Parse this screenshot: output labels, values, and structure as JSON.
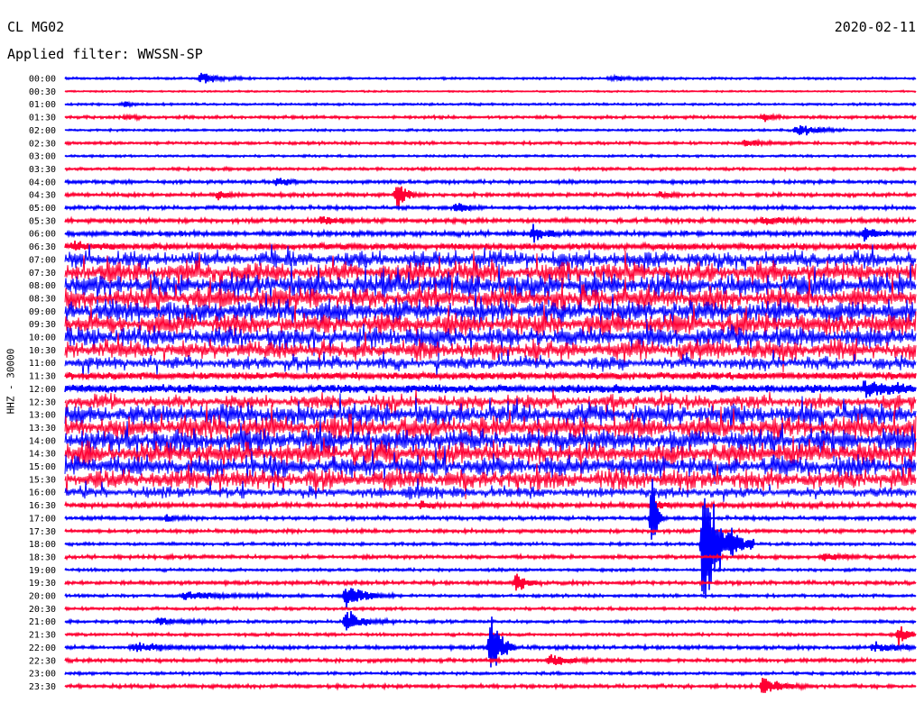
{
  "header": {
    "station": "CL MG02",
    "date": "2020-02-11",
    "filter": "Applied filter: WWSSN-SP"
  },
  "chart_data": {
    "type": "line",
    "title": "",
    "ylabel": "HHZ - 30000",
    "xlabel": "",
    "colors": [
      "#0000ff",
      "#ff0033"
    ],
    "grid": false,
    "legend": "none",
    "rows": [
      {
        "label": "00:00",
        "level": 0.15,
        "color": "#0000ff"
      },
      {
        "label": "00:30",
        "level": 0.1,
        "color": "#ff0033"
      },
      {
        "label": "01:00",
        "level": 0.15,
        "color": "#0000ff"
      },
      {
        "label": "01:30",
        "level": 0.2,
        "color": "#ff0033"
      },
      {
        "label": "02:00",
        "level": 0.15,
        "color": "#0000ff"
      },
      {
        "label": "02:30",
        "level": 0.2,
        "color": "#ff0033"
      },
      {
        "label": "03:00",
        "level": 0.15,
        "color": "#0000ff"
      },
      {
        "label": "03:30",
        "level": 0.2,
        "color": "#ff0033"
      },
      {
        "label": "04:00",
        "level": 0.25,
        "color": "#0000ff"
      },
      {
        "label": "04:30",
        "level": 0.25,
        "color": "#ff0033"
      },
      {
        "label": "05:00",
        "level": 0.25,
        "color": "#0000ff"
      },
      {
        "label": "05:30",
        "level": 0.3,
        "color": "#ff0033"
      },
      {
        "label": "06:00",
        "level": 0.35,
        "color": "#0000ff"
      },
      {
        "label": "06:30",
        "level": 0.45,
        "color": "#ff0033"
      },
      {
        "label": "07:00",
        "level": 1.2,
        "color": "#0000ff"
      },
      {
        "label": "07:30",
        "level": 1.5,
        "color": "#ff0033"
      },
      {
        "label": "08:00",
        "level": 1.6,
        "color": "#0000ff"
      },
      {
        "label": "08:30",
        "level": 1.6,
        "color": "#ff0033"
      },
      {
        "label": "09:00",
        "level": 1.6,
        "color": "#0000ff"
      },
      {
        "label": "09:30",
        "level": 1.5,
        "color": "#ff0033"
      },
      {
        "label": "10:00",
        "level": 1.5,
        "color": "#0000ff"
      },
      {
        "label": "10:30",
        "level": 1.4,
        "color": "#ff0033"
      },
      {
        "label": "11:00",
        "level": 0.9,
        "color": "#0000ff"
      },
      {
        "label": "11:30",
        "level": 0.5,
        "color": "#ff0033"
      },
      {
        "label": "12:00",
        "level": 0.6,
        "color": "#0000ff"
      },
      {
        "label": "12:30",
        "level": 1.0,
        "color": "#ff0033"
      },
      {
        "label": "13:00",
        "level": 1.5,
        "color": "#0000ff"
      },
      {
        "label": "13:30",
        "level": 1.6,
        "color": "#ff0033"
      },
      {
        "label": "14:00",
        "level": 1.6,
        "color": "#0000ff"
      },
      {
        "label": "14:30",
        "level": 1.6,
        "color": "#ff0033"
      },
      {
        "label": "15:00",
        "level": 1.5,
        "color": "#0000ff"
      },
      {
        "label": "15:30",
        "level": 1.4,
        "color": "#ff0033"
      },
      {
        "label": "16:00",
        "level": 0.8,
        "color": "#0000ff"
      },
      {
        "label": "16:30",
        "level": 0.35,
        "color": "#ff0033"
      },
      {
        "label": "17:00",
        "level": 0.25,
        "color": "#0000ff"
      },
      {
        "label": "17:30",
        "level": 0.25,
        "color": "#ff0033"
      },
      {
        "label": "18:00",
        "level": 0.2,
        "color": "#0000ff"
      },
      {
        "label": "18:30",
        "level": 0.25,
        "color": "#ff0033"
      },
      {
        "label": "19:00",
        "level": 0.2,
        "color": "#0000ff"
      },
      {
        "label": "19:30",
        "level": 0.25,
        "color": "#ff0033"
      },
      {
        "label": "20:00",
        "level": 0.2,
        "color": "#0000ff"
      },
      {
        "label": "20:30",
        "level": 0.2,
        "color": "#ff0033"
      },
      {
        "label": "21:00",
        "level": 0.2,
        "color": "#0000ff"
      },
      {
        "label": "21:30",
        "level": 0.2,
        "color": "#ff0033"
      },
      {
        "label": "22:00",
        "level": 0.25,
        "color": "#0000ff"
      },
      {
        "label": "22:30",
        "level": 0.25,
        "color": "#ff0033"
      },
      {
        "label": "23:00",
        "level": 0.2,
        "color": "#0000ff"
      },
      {
        "label": "23:30",
        "level": 0.25,
        "color": "#ff0033"
      }
    ],
    "events": [
      {
        "row": "00:00",
        "t": 0.16,
        "amp": 8,
        "dur": 0.02
      },
      {
        "row": "00:00",
        "t": 0.64,
        "amp": 3,
        "dur": 0.03
      },
      {
        "row": "01:00",
        "t": 0.07,
        "amp": 4,
        "dur": 0.01
      },
      {
        "row": "01:30",
        "t": 0.07,
        "amp": 4,
        "dur": 0.01
      },
      {
        "row": "01:30",
        "t": 0.82,
        "amp": 5,
        "dur": 0.01
      },
      {
        "row": "02:00",
        "t": 0.86,
        "amp": 10,
        "dur": 0.02
      },
      {
        "row": "02:30",
        "t": 0.8,
        "amp": 5,
        "dur": 0.02
      },
      {
        "row": "04:00",
        "t": 0.25,
        "amp": 8,
        "dur": 0.01
      },
      {
        "row": "04:30",
        "t": 0.39,
        "amp": 18,
        "dur": 0.01
      },
      {
        "row": "04:30",
        "t": 0.18,
        "amp": 6,
        "dur": 0.01
      },
      {
        "row": "04:30",
        "t": 0.7,
        "amp": 6,
        "dur": 0.01
      },
      {
        "row": "05:00",
        "t": 0.46,
        "amp": 10,
        "dur": 0.01
      },
      {
        "row": "05:30",
        "t": 0.3,
        "amp": 6,
        "dur": 0.02
      },
      {
        "row": "05:30",
        "t": 0.82,
        "amp": 6,
        "dur": 0.02
      },
      {
        "row": "06:00",
        "t": 0.55,
        "amp": 12,
        "dur": 0.01
      },
      {
        "row": "06:00",
        "t": 0.94,
        "amp": 14,
        "dur": 0.01
      },
      {
        "row": "06:30",
        "t": 0.01,
        "amp": 6,
        "dur": 0.02
      },
      {
        "row": "12:00",
        "t": 0.94,
        "amp": 10,
        "dur": 0.04
      },
      {
        "row": "16:00",
        "t": 0.4,
        "amp": 10,
        "dur": 0.02
      },
      {
        "row": "16:30",
        "t": 0.42,
        "amp": 6,
        "dur": 0.01
      },
      {
        "row": "16:30",
        "t": 0.69,
        "amp": 8,
        "dur": 0.01
      },
      {
        "row": "17:00",
        "t": 0.69,
        "amp": 70,
        "dur": 0.005
      },
      {
        "row": "17:00",
        "t": 0.12,
        "amp": 5,
        "dur": 0.01
      },
      {
        "row": "18:00",
        "t": 0.75,
        "amp": 100,
        "dur": 0.02
      },
      {
        "row": "18:30",
        "t": 0.89,
        "amp": 5,
        "dur": 0.02
      },
      {
        "row": "19:30",
        "t": 0.53,
        "amp": 16,
        "dur": 0.01
      },
      {
        "row": "20:00",
        "t": 0.14,
        "amp": 5,
        "dur": 0.05
      },
      {
        "row": "20:00",
        "t": 0.33,
        "amp": 18,
        "dur": 0.02
      },
      {
        "row": "21:00",
        "t": 0.11,
        "amp": 5,
        "dur": 0.03
      },
      {
        "row": "21:00",
        "t": 0.33,
        "amp": 16,
        "dur": 0.02
      },
      {
        "row": "22:00",
        "t": 0.08,
        "amp": 6,
        "dur": 0.04
      },
      {
        "row": "22:00",
        "t": 0.95,
        "amp": 6,
        "dur": 0.04
      },
      {
        "row": "22:00",
        "t": 0.5,
        "amp": 60,
        "dur": 0.01
      },
      {
        "row": "21:30",
        "t": 0.98,
        "amp": 14,
        "dur": 0.01
      },
      {
        "row": "22:30",
        "t": 0.57,
        "amp": 8,
        "dur": 0.02
      },
      {
        "row": "23:30",
        "t": 0.82,
        "amp": 10,
        "dur": 0.02
      }
    ]
  }
}
